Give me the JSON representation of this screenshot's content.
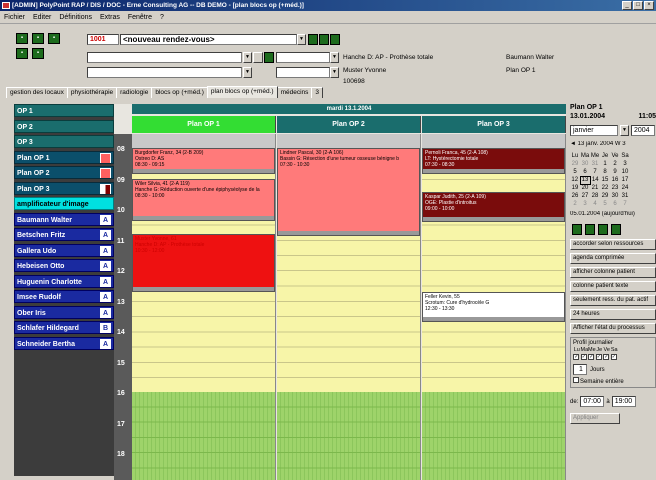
{
  "window": {
    "title": "[ADMIN] PolyPoint RAP / DIS / DOC - Erne Consulting AG  -- DB DEMO - [plan blocs op (+méd.)]"
  },
  "menu": {
    "items": [
      "Fichier",
      "Editer",
      "Définitions",
      "Extras",
      "Fenêtre",
      "?"
    ]
  },
  "toolbar": {
    "number": "1001",
    "appointment": "<nouveau rendez-vous>",
    "patient_line1": "Hanche D: AP - Prothèse totale",
    "patient_line2": "Muster Yvonne",
    "patient_line3": "100698",
    "doctor": "Baumann Walter",
    "room": "Plan OP 1"
  },
  "tabs": [
    "gestion des locaux",
    "physiothérapie",
    "radiologie",
    "blocs op (+méd.)",
    "plan blocs op (+méd.)",
    "médecins",
    "3"
  ],
  "resources": [
    {
      "label": "OP 1",
      "style": "teal"
    },
    {
      "label": "OP 2",
      "style": "teal"
    },
    {
      "label": "OP 3",
      "style": "teal"
    },
    {
      "label": "Plan OP 1",
      "style": "teal-active",
      "box": "red"
    },
    {
      "label": "Plan OP 2",
      "style": "teal-active",
      "box": "red"
    },
    {
      "label": "Plan OP 3",
      "style": "teal-active",
      "box": "half"
    },
    {
      "label": "amplificateur d'image",
      "style": "cyan"
    },
    {
      "label": "Baumann Walter",
      "style": "blue",
      "box": "A"
    },
    {
      "label": "Betschen Fritz",
      "style": "blue",
      "box": "A"
    },
    {
      "label": "Gallera Udo",
      "style": "blue",
      "box": "A"
    },
    {
      "label": "Hebeisen Otto",
      "style": "blue",
      "box": "A"
    },
    {
      "label": "Huguenin Charlotte",
      "style": "blue",
      "box": "A"
    },
    {
      "label": "Imsee Rudolf",
      "style": "blue",
      "box": "A"
    },
    {
      "label": "Ober Iris",
      "style": "blue",
      "box": "A"
    },
    {
      "label": "Schlafer Hildegard",
      "style": "blue",
      "box": "B"
    },
    {
      "label": "Schneider Bertha",
      "style": "blue",
      "box": "A"
    }
  ],
  "calendar": {
    "date_header": "mardi 13.1.2004",
    "columns": [
      "Plan OP 1",
      "Plan OP 2",
      "Plan OP 3"
    ],
    "hours": [
      "08",
      "09",
      "10",
      "11",
      "12",
      "13",
      "14",
      "15",
      "16",
      "17",
      "18"
    ],
    "appointments": [
      {
        "col": 0,
        "lines": [
          "Burgdorfer Franz, 34 (2-B 209)",
          "Ostreo D: AS",
          "08:30 - 09:15"
        ]
      },
      {
        "col": 0,
        "lines": [
          "Wiler Silvia, 41 (2-A 119)",
          "Hanche G: Réduction ouverte d'une épiphyséolyse de la",
          "08:30 - 10:00"
        ]
      },
      {
        "col": 0,
        "lines": [
          "Muster Yvonne, 61",
          "Hanche D: AP - Prothèse totale",
          "10:30 - 12:00"
        ]
      },
      {
        "col": 1,
        "lines": [
          "Lindner Pascal, 30 (2-A 106)",
          "Bassin G: Résection d'une tumeur osseuse bénigne b",
          "07:30 - 10:30"
        ]
      },
      {
        "col": 2,
        "lines": [
          "Pernoli Franca, 45 (2-A 108)",
          "LT: Hystérectomie totale",
          "07:30 - 08:30"
        ]
      },
      {
        "col": 2,
        "lines": [
          "Kaspar Judith, 25 (2-A 109)",
          "OGE: Plastie d'introitus",
          "09:00 - 10:00"
        ]
      },
      {
        "col": 2,
        "lines": [
          "Feller Kevin, 55",
          "Scrotum: Cure d'hydrocèle G",
          "12:30 - 13:30"
        ]
      }
    ]
  },
  "sidepanel": {
    "title": "Plan OP 1",
    "date": "13.01.2004",
    "time": "11:05",
    "month": "janvier",
    "year": "2004",
    "nav_label": "13 janv. 2004  W 3",
    "weekdays": [
      "Lu",
      "Ma",
      "Me",
      "Je",
      "Ve",
      "Sa"
    ],
    "weeks": [
      [
        "29",
        "30",
        "31",
        "1",
        "2",
        "3"
      ],
      [
        "5",
        "6",
        "7",
        "8",
        "9",
        "10"
      ],
      [
        "12",
        "13",
        "14",
        "15",
        "16",
        "17"
      ],
      [
        "19",
        "20",
        "21",
        "22",
        "23",
        "24"
      ],
      [
        "26",
        "27",
        "28",
        "29",
        "30",
        "31"
      ],
      [
        "2",
        "3",
        "4",
        "5",
        "6",
        "7"
      ]
    ],
    "today": "05.01.2004 (aujourd'hui)",
    "buttons": [
      "accorder selon ressources",
      "agenda comprimée",
      "afficher colonne patient",
      "colonne patient texte",
      "seulement ress. du pat. actif",
      "24 heures",
      "Afficher l'état du processus"
    ],
    "profile_label": "Profil journalier",
    "profile_days": [
      "Lu",
      "Ma",
      "Me",
      "Je",
      "Ve",
      "Sa"
    ],
    "days_value": "1",
    "days_label": "Jours",
    "week_label": "Semaine entière",
    "from_label": "de:",
    "from_value": "07:00",
    "to_label": "à",
    "to_value": "19:00",
    "apply_label": "Appliquer"
  },
  "colors": {
    "green_head": "#33dd33",
    "teal": "#1a6d6d",
    "salmon": "#ff7a7a",
    "red": "#ee1111",
    "dark_red": "#7a0c0c",
    "yellow": "#f7f5a8",
    "green_grid": "#9ed36a"
  }
}
